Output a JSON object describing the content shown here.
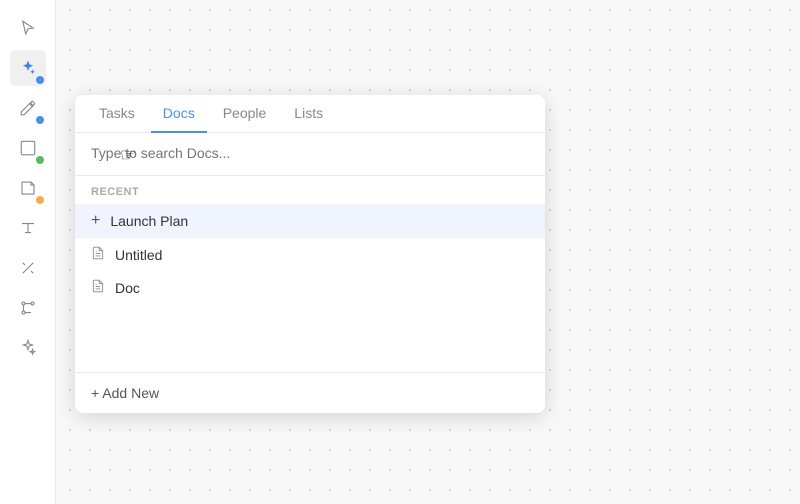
{
  "background": {
    "dot_color": "#c8c8c8"
  },
  "sidebar": {
    "items": [
      {
        "id": "cursor",
        "icon": "cursor",
        "active": false
      },
      {
        "id": "magic",
        "icon": "magic",
        "active": true,
        "dot": "blue"
      },
      {
        "id": "pencil",
        "icon": "pencil",
        "active": false,
        "dot": "blue"
      },
      {
        "id": "shape",
        "icon": "shape",
        "active": false,
        "dot": "green"
      },
      {
        "id": "sticky",
        "icon": "sticky",
        "active": false,
        "dot": "yellow"
      },
      {
        "id": "text",
        "icon": "text",
        "active": false
      },
      {
        "id": "line",
        "icon": "line",
        "active": false
      },
      {
        "id": "connect",
        "icon": "connect",
        "active": false
      },
      {
        "id": "magic2",
        "icon": "magic2",
        "active": false
      }
    ]
  },
  "popup": {
    "tabs": [
      {
        "id": "tasks",
        "label": "Tasks",
        "active": false
      },
      {
        "id": "docs",
        "label": "Docs",
        "active": true
      },
      {
        "id": "people",
        "label": "People",
        "active": false
      },
      {
        "id": "lists",
        "label": "Lists",
        "active": false
      }
    ],
    "search": {
      "placeholder": "Type to search Docs..."
    },
    "recent_label": "RECENT",
    "docs": [
      {
        "id": "launch-plan",
        "title": "Launch Plan",
        "type": "plus",
        "highlighted": true
      },
      {
        "id": "untitled",
        "title": "Untitled",
        "type": "doc",
        "highlighted": false
      },
      {
        "id": "doc",
        "title": "Doc",
        "type": "doc",
        "highlighted": false
      }
    ],
    "add_new_label": "+ Add New"
  }
}
